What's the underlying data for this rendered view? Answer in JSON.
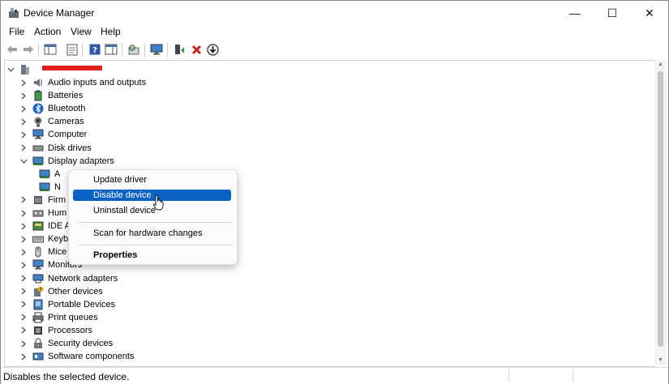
{
  "window": {
    "title": "Device Manager",
    "controls": {
      "minimize": "—",
      "maximize": "☐",
      "close": "✕"
    }
  },
  "menubar": [
    "File",
    "Action",
    "View",
    "Help"
  ],
  "toolbar": [
    "back-icon",
    "forward-icon",
    "show-hide-console-tree-icon",
    "properties-icon",
    "help-icon",
    "show-action-pane-icon",
    "scan-hardware-icon",
    "monitor-icon",
    "update-driver-icon",
    "uninstall-device-icon",
    "enable-device-icon"
  ],
  "tree": {
    "root_label": "",
    "items": [
      {
        "label": "Audio inputs and outputs",
        "icon": "speaker-icon",
        "expanded": false
      },
      {
        "label": "Batteries",
        "icon": "battery-icon",
        "expanded": false
      },
      {
        "label": "Bluetooth",
        "icon": "bluetooth-icon",
        "expanded": false
      },
      {
        "label": "Cameras",
        "icon": "camera-icon",
        "expanded": false
      },
      {
        "label": "Computer",
        "icon": "computer-icon",
        "expanded": false
      },
      {
        "label": "Disk drives",
        "icon": "disk-drive-icon",
        "expanded": false
      },
      {
        "label": "Display adapters",
        "icon": "display-adapter-icon",
        "expanded": true
      },
      {
        "label": "A",
        "icon": "display-adapter-icon",
        "child": true
      },
      {
        "label": "N",
        "icon": "display-adapter-icon",
        "child": true
      },
      {
        "label": "Firm",
        "icon": "firmware-icon",
        "expanded": false
      },
      {
        "label": "Hum",
        "icon": "hid-icon",
        "expanded": false
      },
      {
        "label": "IDE A",
        "icon": "ide-icon",
        "expanded": false
      },
      {
        "label": "Keyb",
        "icon": "keyboard-icon",
        "expanded": false
      },
      {
        "label": "Mice",
        "icon": "mouse-icon",
        "expanded": false
      },
      {
        "label": "Monitors",
        "icon": "monitor-icon",
        "expanded": false
      },
      {
        "label": "Network adapters",
        "icon": "network-adapter-icon",
        "expanded": false
      },
      {
        "label": "Other devices",
        "icon": "other-devices-icon",
        "expanded": false
      },
      {
        "label": "Portable Devices",
        "icon": "portable-device-icon",
        "expanded": false
      },
      {
        "label": "Print queues",
        "icon": "printer-icon",
        "expanded": false
      },
      {
        "label": "Processors",
        "icon": "processor-icon",
        "expanded": false
      },
      {
        "label": "Security devices",
        "icon": "security-device-icon",
        "expanded": false
      },
      {
        "label": "Software components",
        "icon": "software-component-icon",
        "expanded": false
      }
    ]
  },
  "context_menu": {
    "items": [
      {
        "label": "Update driver",
        "selected": false
      },
      {
        "label": "Disable device",
        "selected": true
      },
      {
        "label": "Uninstall device",
        "selected": false
      },
      {
        "label": "Scan for hardware changes",
        "selected": false
      },
      {
        "label": "Properties",
        "selected": false,
        "bold": true
      }
    ]
  },
  "status": {
    "message": "Disables the selected device."
  },
  "colors": {
    "selection": "#0b64c4",
    "redaction": "#e22020"
  }
}
